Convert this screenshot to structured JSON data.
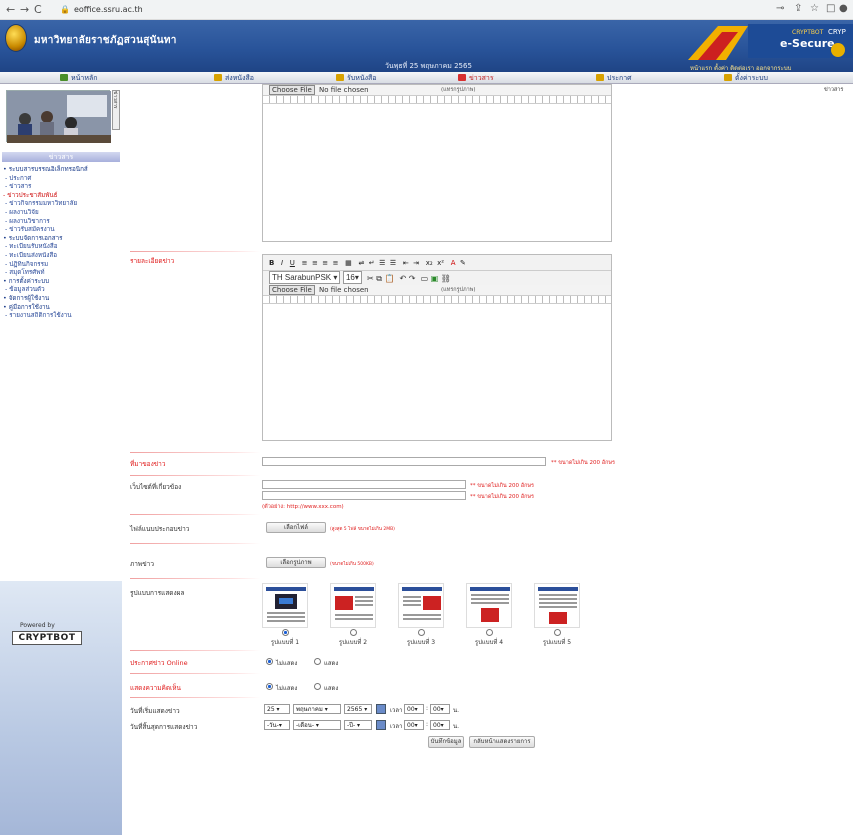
{
  "browser": {
    "url": "eoffice.ssru.ac.th",
    "back_icon": "arrow-left-icon",
    "forward_icon": "arrow-right-icon",
    "reload_icon": "reload-icon"
  },
  "header": {
    "site_title": "มหาวิทยาลัยราชภัฏสวนสุนันทา",
    "date_line": "วันพุธที่ 25 พฤษภาคม 2565",
    "banner_line1": "CRYPTBOT",
    "banner_line2": "e-Secure",
    "banner_line3": "CRYP",
    "links": "หน้าแรก  ตั้งค่า  ติดต่อเรา  ออกจากระบบ"
  },
  "menu": {
    "items": [
      "หน้าหลัก",
      "ส่งหนังสือ",
      "รับหนังสือ",
      "ข่าวสาร",
      "ประกาศ",
      "ตั้งค่าระบบ"
    ],
    "right": "ข่าวสาร"
  },
  "sidebar": {
    "header": "ข่าวสาร",
    "items": [
      {
        "text": "• ระบบสารบรรณอิเล็กทรอนิกส์",
        "style": "head"
      },
      {
        "text": "- ประกาศ",
        "style": "sub"
      },
      {
        "text": "- ข่าวสาร",
        "style": "sub"
      },
      {
        "text": "- ข่าวประชาสัมพันธ์",
        "style": "red"
      },
      {
        "text": "- ข่าวกิจกรรมมหาวิทยาลัย",
        "style": "sub"
      },
      {
        "text": "- ผลงานวิจัย",
        "style": "sub"
      },
      {
        "text": "- ผลงานวิชาการ ",
        "style": "sub"
      },
      {
        "text": "- ข่าวรับสมัครงาน",
        "style": "sub"
      },
      {
        "text": "• ระบบจัดการเอกสาร",
        "style": "head"
      },
      {
        "text": "- ทะเบียนรับหนังสือ",
        "style": "sub"
      },
      {
        "text": "- ทะเบียนส่งหนังสือ",
        "style": "sub"
      },
      {
        "text": "- ปฏิทินกิจกรรม",
        "style": "sub"
      },
      {
        "text": "- สมุดโทรศัพท์",
        "style": "sub"
      },
      {
        "text": "• การตั้งค่าระบบ",
        "style": "head"
      },
      {
        "text": "- ข้อมูลส่วนตัว",
        "style": "sub"
      },
      {
        "text": "• จัดการผู้ใช้งาน",
        "style": "head"
      },
      {
        "text": "• คู่มือการใช้งาน",
        "style": "head"
      },
      {
        "text": "- รายงานสถิติการใช้งาน",
        "style": "sub"
      }
    ],
    "vert_label": "ข่าวสาร",
    "powered": "Powered by",
    "cryptbot": "CRYPTBOT"
  },
  "editor": {
    "choose_file": "Choose File",
    "no_file": "No file chosen",
    "file_hint": "(แทรกรูปภาพ)",
    "font_name": "TH SarabunPSK",
    "font_size": "16"
  },
  "form": {
    "detail_label": "รายละเอียดข่าว",
    "source_label": "ที่มาของข่าว",
    "source_note": "** ขนาดไม่เกิน 200 อักษร",
    "link_label": "เว็บไซต์ที่เกี่ยวข้อง",
    "link_note1": "** ขนาดไม่เกิน 200 อักษร",
    "link_note2": "** ขนาดไม่เกิน 200 อักษร",
    "link_hint": "(ตัวอย่าง: http://www.xxx.com)",
    "attach_label": "ไฟล์แนบประกอบข่าว",
    "attach_button": "เลือกไฟล์",
    "attach_note": "(สูงสุด 5 ไฟล์ ขนาดไม่เกิน 2MB)",
    "image_label": "ภาพข่าว",
    "image_button": "เลือกรูปภาพ",
    "image_note": "(ขนาดไม่เกิน 500KB)",
    "layout_label": "รูปแบบการแสดงผล",
    "layouts": [
      "รูปแบบที่ 1",
      "รูปแบบที่ 2",
      "รูปแบบที่ 3",
      "รูปแบบที่ 4",
      "รูปแบบที่ 5"
    ],
    "online_label": "ประกาศข่าว Online",
    "online_opt1": "ไม่แสดง",
    "online_opt2": "แสดง",
    "comment_label": "แสดงความคิดเห็น",
    "comment_opt1": "ไม่แสดง",
    "comment_opt2": "แสดง",
    "start_label": "วันที่เริ่มแสดงข่าว",
    "end_label": "วันที่สิ้นสุดการแสดงข่าว",
    "start_day": "25",
    "start_month": "พฤษภาคม",
    "start_year": "2565",
    "start_hour": "00",
    "start_min": "00",
    "end_day": "-วัน-",
    "end_month": "-เดือน-",
    "end_year": "-ปี-",
    "end_hour": "00",
    "end_min": "00",
    "time_label": "เวลา",
    "unit": "น.",
    "save_button": "บันทึกข้อมูล",
    "back_button": "กลับหน้าแสดงรายการ"
  },
  "colors": {
    "header": "#29549a",
    "label_red": "#e01c1c",
    "accent_blue": "#1a5fd6"
  }
}
